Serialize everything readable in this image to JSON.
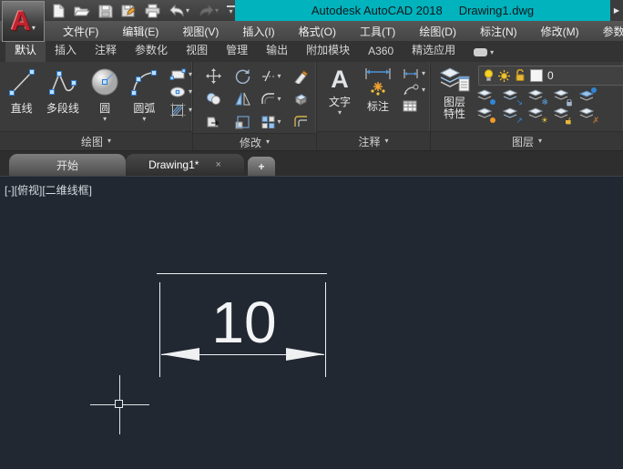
{
  "colors": {
    "accent_teal": "#00b3bd",
    "canvas_bg": "#222832",
    "ribbon_bg": "#3b3b3b",
    "logo_red": "#c2232e",
    "dimension_color": "#eef0f2"
  },
  "title_bar": {
    "app_title": "Autodesk AutoCAD 2018",
    "doc_title": "Drawing1.dwg"
  },
  "menu_bar": {
    "items": [
      "文件(F)",
      "编辑(E)",
      "视图(V)",
      "插入(I)",
      "格式(O)",
      "工具(T)",
      "绘图(D)",
      "标注(N)",
      "修改(M)",
      "参数(P)"
    ]
  },
  "ribbon": {
    "tabs": [
      "默认",
      "插入",
      "注释",
      "参数化",
      "视图",
      "管理",
      "输出",
      "附加模块",
      "A360",
      "精选应用"
    ],
    "active_tab": "默认",
    "panels": {
      "draw": {
        "label": "绘图",
        "buttons": [
          "直线",
          "多段线",
          "圆",
          "圆弧"
        ]
      },
      "modify": {
        "label": "修改"
      },
      "annotate": {
        "label": "注释",
        "text_button": "文字",
        "dim_button": "标注"
      },
      "layers": {
        "label": "图层",
        "props_line1": "图层",
        "props_line2": "特性",
        "current_layer": "0"
      }
    }
  },
  "file_tabs": {
    "start_tab": "开始",
    "drawing_tab": "Drawing1*",
    "new_tab": "+"
  },
  "viewport": {
    "controls_label": "[-][俯视][二维线框]"
  },
  "canvas": {
    "dimension_value": "10"
  },
  "icons": {
    "caret_down": "▾",
    "close": "×",
    "right_arrow": "▶",
    "letter_a": "A",
    "snowflake": "❄",
    "sun": "☀",
    "arrow_up_right": "↗",
    "arrow_down_right": "↘",
    "cross_mark": "✗"
  }
}
